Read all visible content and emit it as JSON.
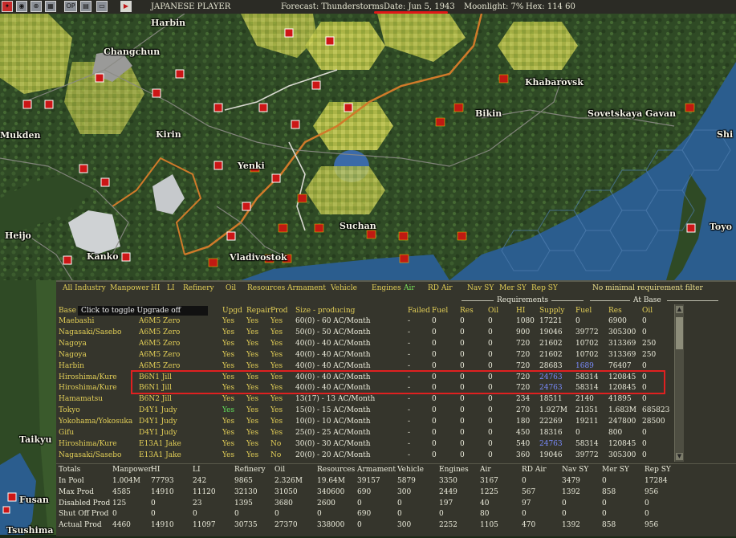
{
  "topbar": {
    "buttons": [
      "OP"
    ],
    "player": "JAPANESE PLAYER",
    "forecast": "Forecast: Thunderstorms",
    "date": "Date: Jun 5, 1943",
    "moonlight": "Moonlight: 7%",
    "hex": "Hex: 114 60"
  },
  "map": {
    "cities": [
      "Harbin",
      "Changchun",
      "Khabarovsk",
      "Mukden",
      "Kirin",
      "Bikin",
      "Sovetskaya Gavan",
      "Shi",
      "Yenki",
      "Suchan",
      "Vladivostok",
      "Heijo",
      "Kanko",
      "Toyo",
      "Taikyu",
      "Fusan",
      "Tsushima"
    ],
    "colors": {
      "forest": "#2e4a24",
      "hex_highlight": "#c9d65a",
      "sea": "#2b5d8e",
      "border": "#d07a2a",
      "soviet": "#c01a12",
      "japan": "#cc1616"
    }
  },
  "panel": {
    "filters": [
      "All Industry",
      "Manpower",
      "HI",
      "LI",
      "Refinery",
      "Oil",
      "Resources",
      "Armament",
      "Vehicle",
      "Engines",
      "Air",
      "RD Air",
      "Nav SY",
      "Mer SY",
      "Rep SY"
    ],
    "active_filter": "Air",
    "min_filter": "No minimal requirement filter",
    "requirements_label": "Requirements",
    "at_base_label": "At Base",
    "tooltip": "Click to toggle Upgrade off",
    "headers": [
      "Base",
      "Upgd",
      "Repair",
      "Prod",
      "Size - producing",
      "Failed",
      "Fuel",
      "Res",
      "Oil",
      "HI",
      "Supply",
      "Fuel",
      "Res",
      "Oil"
    ],
    "rows": [
      [
        "Maebashi",
        "A6M5 Zero",
        "Yes",
        "Yes",
        "Yes",
        "60(0) - 60 AC/Month",
        "-",
        "0",
        "0",
        "0",
        "1080",
        "17221",
        "0",
        "6900",
        "0"
      ],
      [
        "Nagasaki/Sasebo",
        "A6M5 Zero",
        "Yes",
        "Yes",
        "Yes",
        "50(0) - 50 AC/Month",
        "-",
        "0",
        "0",
        "0",
        "900",
        "19046",
        "39772",
        "305300",
        "0"
      ],
      [
        "Nagoya",
        "A6M5 Zero",
        "Yes",
        "Yes",
        "Yes",
        "40(0) - 40 AC/Month",
        "-",
        "0",
        "0",
        "0",
        "720",
        "21602",
        "10702",
        "313369",
        "250"
      ],
      [
        "Nagoya",
        "A6M5 Zero",
        "Yes",
        "Yes",
        "Yes",
        "40(0) - 40 AC/Month",
        "-",
        "0",
        "0",
        "0",
        "720",
        "21602",
        "10702",
        "313369",
        "250"
      ],
      [
        "Harbin",
        "A6M5 Zero",
        "Yes",
        "Yes",
        "Yes",
        "40(0) - 40 AC/Month",
        "-",
        "0",
        "0",
        "0",
        "720",
        "28683",
        "1689",
        "76407",
        "0"
      ],
      [
        "Hiroshima/Kure",
        "B6N1 Jill",
        "Yes",
        "Yes",
        "Yes",
        "40(0) - 40 AC/Month",
        "-",
        "0",
        "0",
        "0",
        "720",
        "24763",
        "58314",
        "120845",
        "0"
      ],
      [
        "Hiroshima/Kure",
        "B6N1 Jill",
        "Yes",
        "Yes",
        "Yes",
        "40(0) - 40 AC/Month",
        "-",
        "0",
        "0",
        "0",
        "720",
        "24763",
        "58314",
        "120845",
        "0"
      ],
      [
        "Hamamatsu",
        "B6N2 Jill",
        "Yes",
        "Yes",
        "Yes",
        "13(17) - 13 AC/Month",
        "-",
        "0",
        "0",
        "0",
        "234",
        "18511",
        "2140",
        "41895",
        "0"
      ],
      [
        "Tokyo",
        "D4Y1 Judy",
        "Yes",
        "Yes",
        "Yes",
        "15(0) - 15 AC/Month",
        "-",
        "0",
        "0",
        "0",
        "270",
        "1.927M",
        "21351",
        "1.683M",
        "685823"
      ],
      [
        "Yokohama/Yokosuka",
        "D4Y1 Judy",
        "Yes",
        "Yes",
        "Yes",
        "10(0) - 10 AC/Month",
        "-",
        "0",
        "0",
        "0",
        "180",
        "22269",
        "19211",
        "247800",
        "28500"
      ],
      [
        "Gifu",
        "D4Y1 Judy",
        "Yes",
        "Yes",
        "Yes",
        "25(0) - 25 AC/Month",
        "-",
        "0",
        "0",
        "0",
        "450",
        "18316",
        "0",
        "800",
        "0"
      ],
      [
        "Hiroshima/Kure",
        "E13A1 Jake",
        "Yes",
        "Yes",
        "No",
        "30(0) - 30 AC/Month",
        "-",
        "0",
        "0",
        "0",
        "540",
        "24763",
        "58314",
        "120845",
        "0"
      ],
      [
        "Nagasaki/Sasebo",
        "E13A1 Jake",
        "Yes",
        "Yes",
        "No",
        "20(0) - 20 AC/Month",
        "-",
        "0",
        "0",
        "0",
        "360",
        "19046",
        "39772",
        "305300",
        "0"
      ]
    ],
    "totals_headers": [
      "Totals",
      "Manpower",
      "HI",
      "LI",
      "Refinery",
      "Oil",
      "Resources",
      "Armament",
      "Vehicle",
      "Engines",
      "Air",
      "RD Air",
      "Nav SY",
      "Mer SY",
      "Rep SY"
    ],
    "totals": [
      [
        "In Pool",
        "1.004M",
        "77793",
        "242",
        "9865",
        "2.326M",
        "19.64M",
        "39157",
        "5879",
        "3350",
        "3167",
        "0",
        "3479",
        "0",
        "17284"
      ],
      [
        "Max Prod",
        "4585",
        "14910",
        "11120",
        "32130",
        "31050",
        "340600",
        "690",
        "300",
        "2449",
        "1225",
        "567",
        "1392",
        "858",
        "956"
      ],
      [
        "Disabled Prod",
        "125",
        "0",
        "23",
        "1395",
        "3680",
        "2600",
        "0",
        "0",
        "197",
        "40",
        "97",
        "0",
        "0",
        "0"
      ],
      [
        "Shut Off Prod",
        "0",
        "0",
        "0",
        "0",
        "0",
        "0",
        "690",
        "0",
        "0",
        "80",
        "0",
        "0",
        "0",
        "0"
      ],
      [
        "Actual Prod",
        "4460",
        "14910",
        "11097",
        "30735",
        "27370",
        "338000",
        "0",
        "300",
        "2252",
        "1105",
        "470",
        "1392",
        "858",
        "956"
      ]
    ]
  }
}
